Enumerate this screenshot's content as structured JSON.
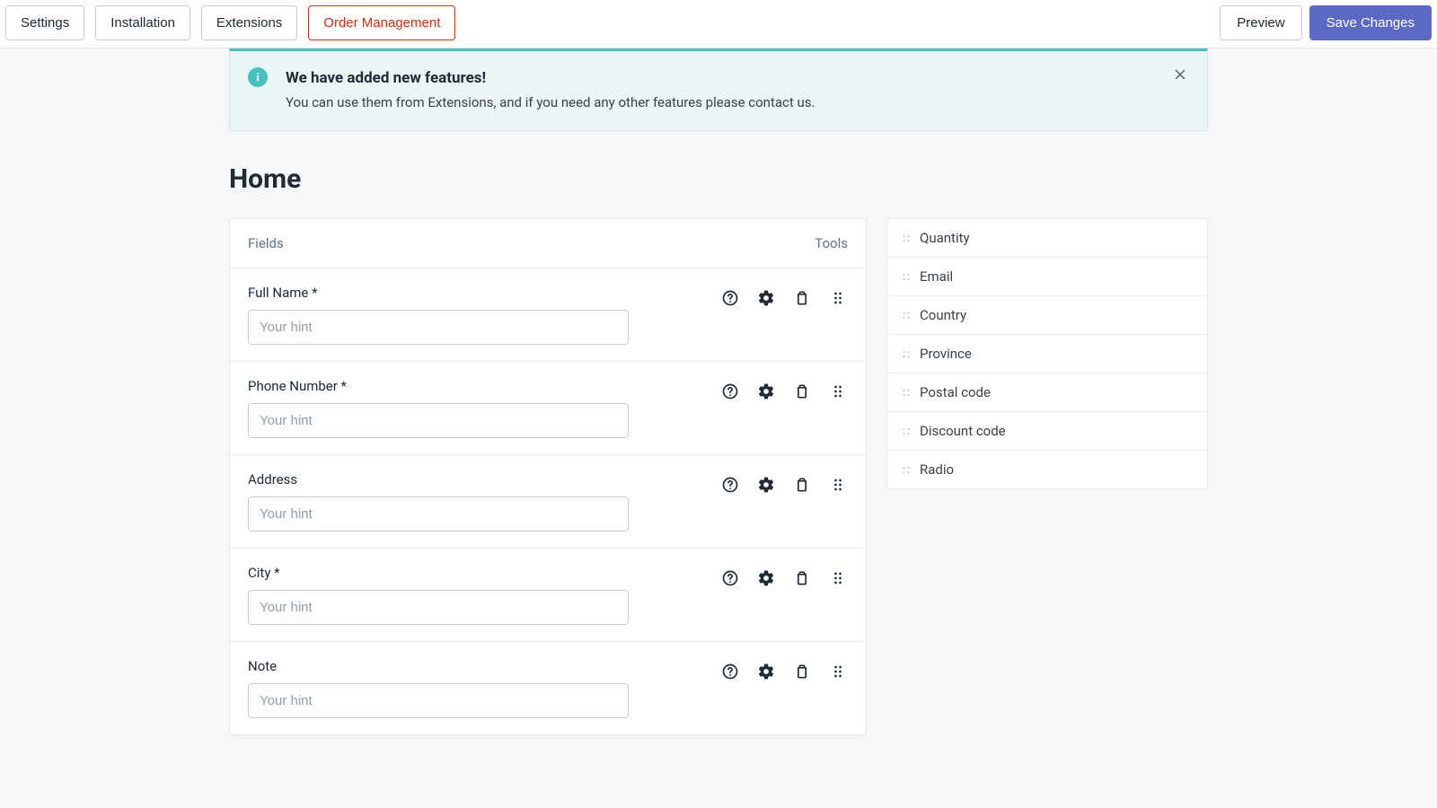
{
  "tabs": [
    {
      "label": "Settings",
      "active": false
    },
    {
      "label": "Installation",
      "active": false
    },
    {
      "label": "Extensions",
      "active": false
    },
    {
      "label": "Order Management",
      "active": true
    }
  ],
  "actions": {
    "preview": "Preview",
    "save": "Save Changes"
  },
  "alert": {
    "icon": "i",
    "title": "We have added new features!",
    "body": "You can use them from Extensions, and if you need any other features please contact us."
  },
  "page_title": "Home",
  "panel": {
    "left_header": "Fields",
    "right_header": "Tools"
  },
  "fields": [
    {
      "label": "Full Name *",
      "placeholder": "Your hint"
    },
    {
      "label": "Phone Number *",
      "placeholder": "Your hint"
    },
    {
      "label": "Address",
      "placeholder": "Your hint"
    },
    {
      "label": "City *",
      "placeholder": "Your hint"
    },
    {
      "label": "Note",
      "placeholder": "Your hint"
    }
  ],
  "available_fields": [
    "Quantity",
    "Email",
    "Country",
    "Province",
    "Postal code",
    "Discount code",
    "Radio"
  ]
}
